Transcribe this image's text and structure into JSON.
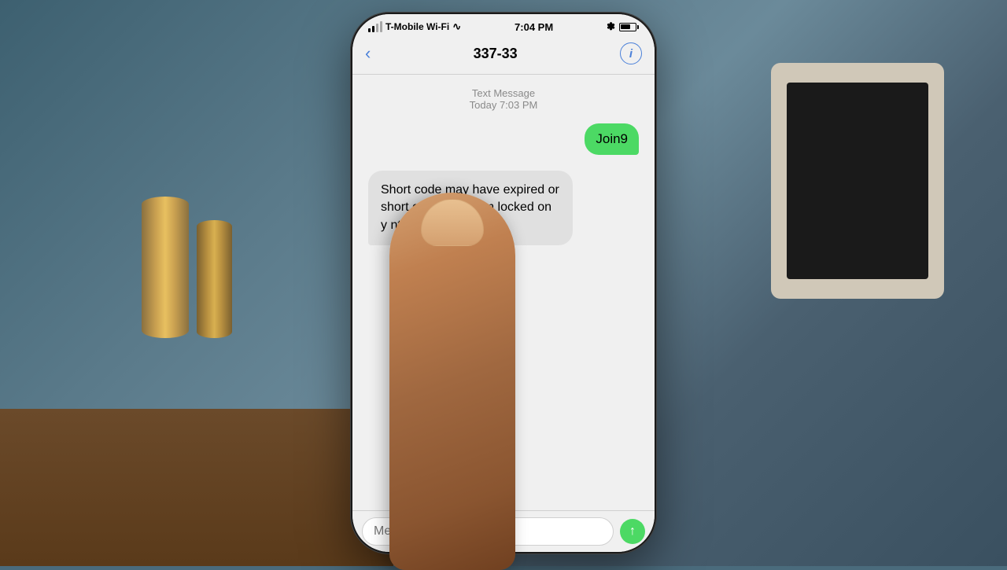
{
  "scene": {
    "background_color": "#4a6b7c"
  },
  "status_bar": {
    "carrier": "T-Mobile Wi-Fi",
    "wifi_symbol": "▲",
    "time": "7:04 PM",
    "bluetooth": "✱",
    "battery_level": 65
  },
  "nav": {
    "back_label": "‹",
    "title": "337-33",
    "info_label": "i"
  },
  "messages": {
    "header_type": "Text Message",
    "header_time": "Today 7:03 PM",
    "sent_bubble": "Join9",
    "received_bubble": "Short code may have expired or short code texting m      locked on y      nt. Msg"
  },
  "input": {
    "placeholder": "Message",
    "send_icon": "↑"
  }
}
